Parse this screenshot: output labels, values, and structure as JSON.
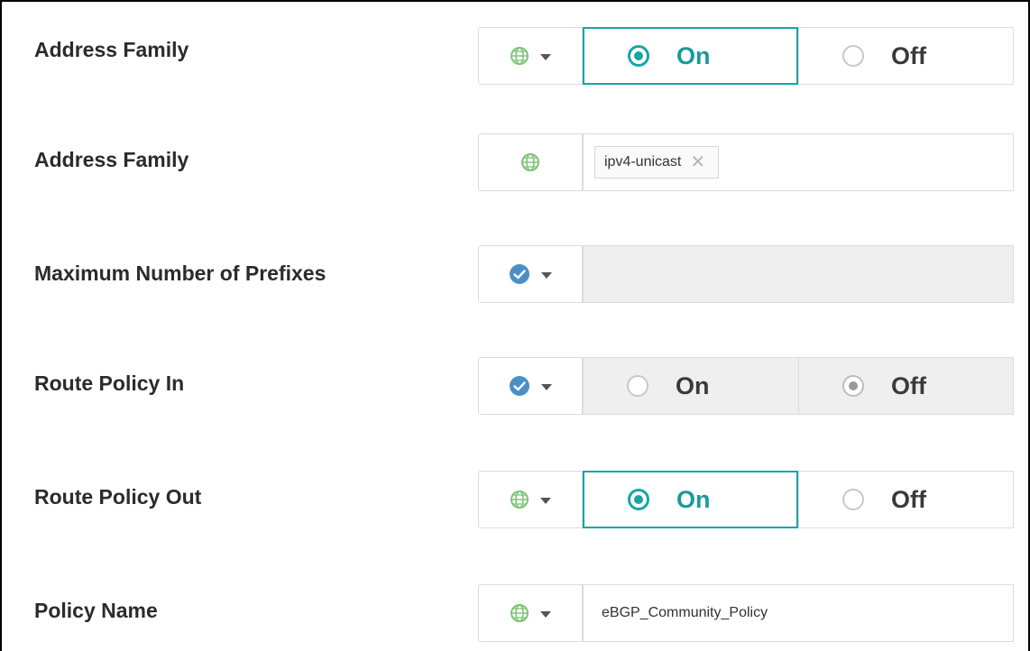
{
  "rows": [
    {
      "label": "Address Family",
      "scope_icon": "globe-icon",
      "type": "toggle",
      "options": [
        "On",
        "Off"
      ],
      "selected": "On",
      "enabled": true
    },
    {
      "label": "Address Family",
      "scope_icon": "globe-icon",
      "type": "tags",
      "tags": [
        {
          "text": "ipv4-unicast",
          "remove": "✕"
        }
      ]
    },
    {
      "label": "Maximum Number of Prefixes",
      "scope_icon": "check-icon",
      "type": "text",
      "value": "",
      "enabled": false
    },
    {
      "label": "Route Policy In",
      "scope_icon": "check-icon",
      "type": "toggle",
      "options": [
        "On",
        "Off"
      ],
      "selected": "Off",
      "enabled": false
    },
    {
      "label": "Route Policy Out",
      "scope_icon": "globe-icon",
      "type": "toggle",
      "options": [
        "On",
        "Off"
      ],
      "selected": "On",
      "enabled": true
    },
    {
      "label": "Policy Name",
      "scope_icon": "globe-icon",
      "type": "text",
      "value": "eBGP_Community_Policy",
      "enabled": true
    }
  ],
  "colors": {
    "accent": "#1aa5a5",
    "globe": "#7cc576",
    "check": "#4a90c8"
  }
}
